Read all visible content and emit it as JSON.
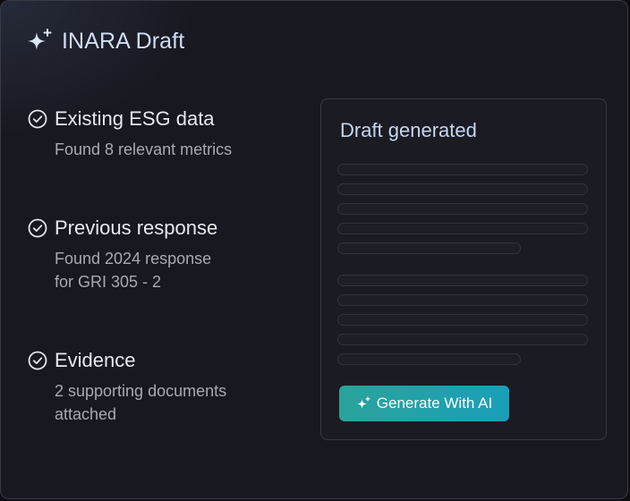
{
  "header": {
    "title": "INARA Draft",
    "icon": "sparkle-icon"
  },
  "steps": [
    {
      "label": "Existing ESG data",
      "desc": [
        "Found 8 relevant metrics"
      ],
      "icon": "check-circle-icon"
    },
    {
      "label": "Previous response",
      "desc": [
        "Found 2024 response",
        "for GRI 305 - 2"
      ],
      "icon": "check-circle-icon"
    },
    {
      "label": "Evidence",
      "desc": [
        "2 supporting documents",
        "attached"
      ],
      "icon": "check-circle-icon"
    }
  ],
  "panel": {
    "title": "Draft generated",
    "button": {
      "label": "Generate With AI",
      "icon": "sparkle-icon"
    }
  },
  "colors": {
    "background": "#181820",
    "title": "#d2ddf5",
    "accent_start": "#2aa39a",
    "accent_end": "#1a9fb9"
  }
}
